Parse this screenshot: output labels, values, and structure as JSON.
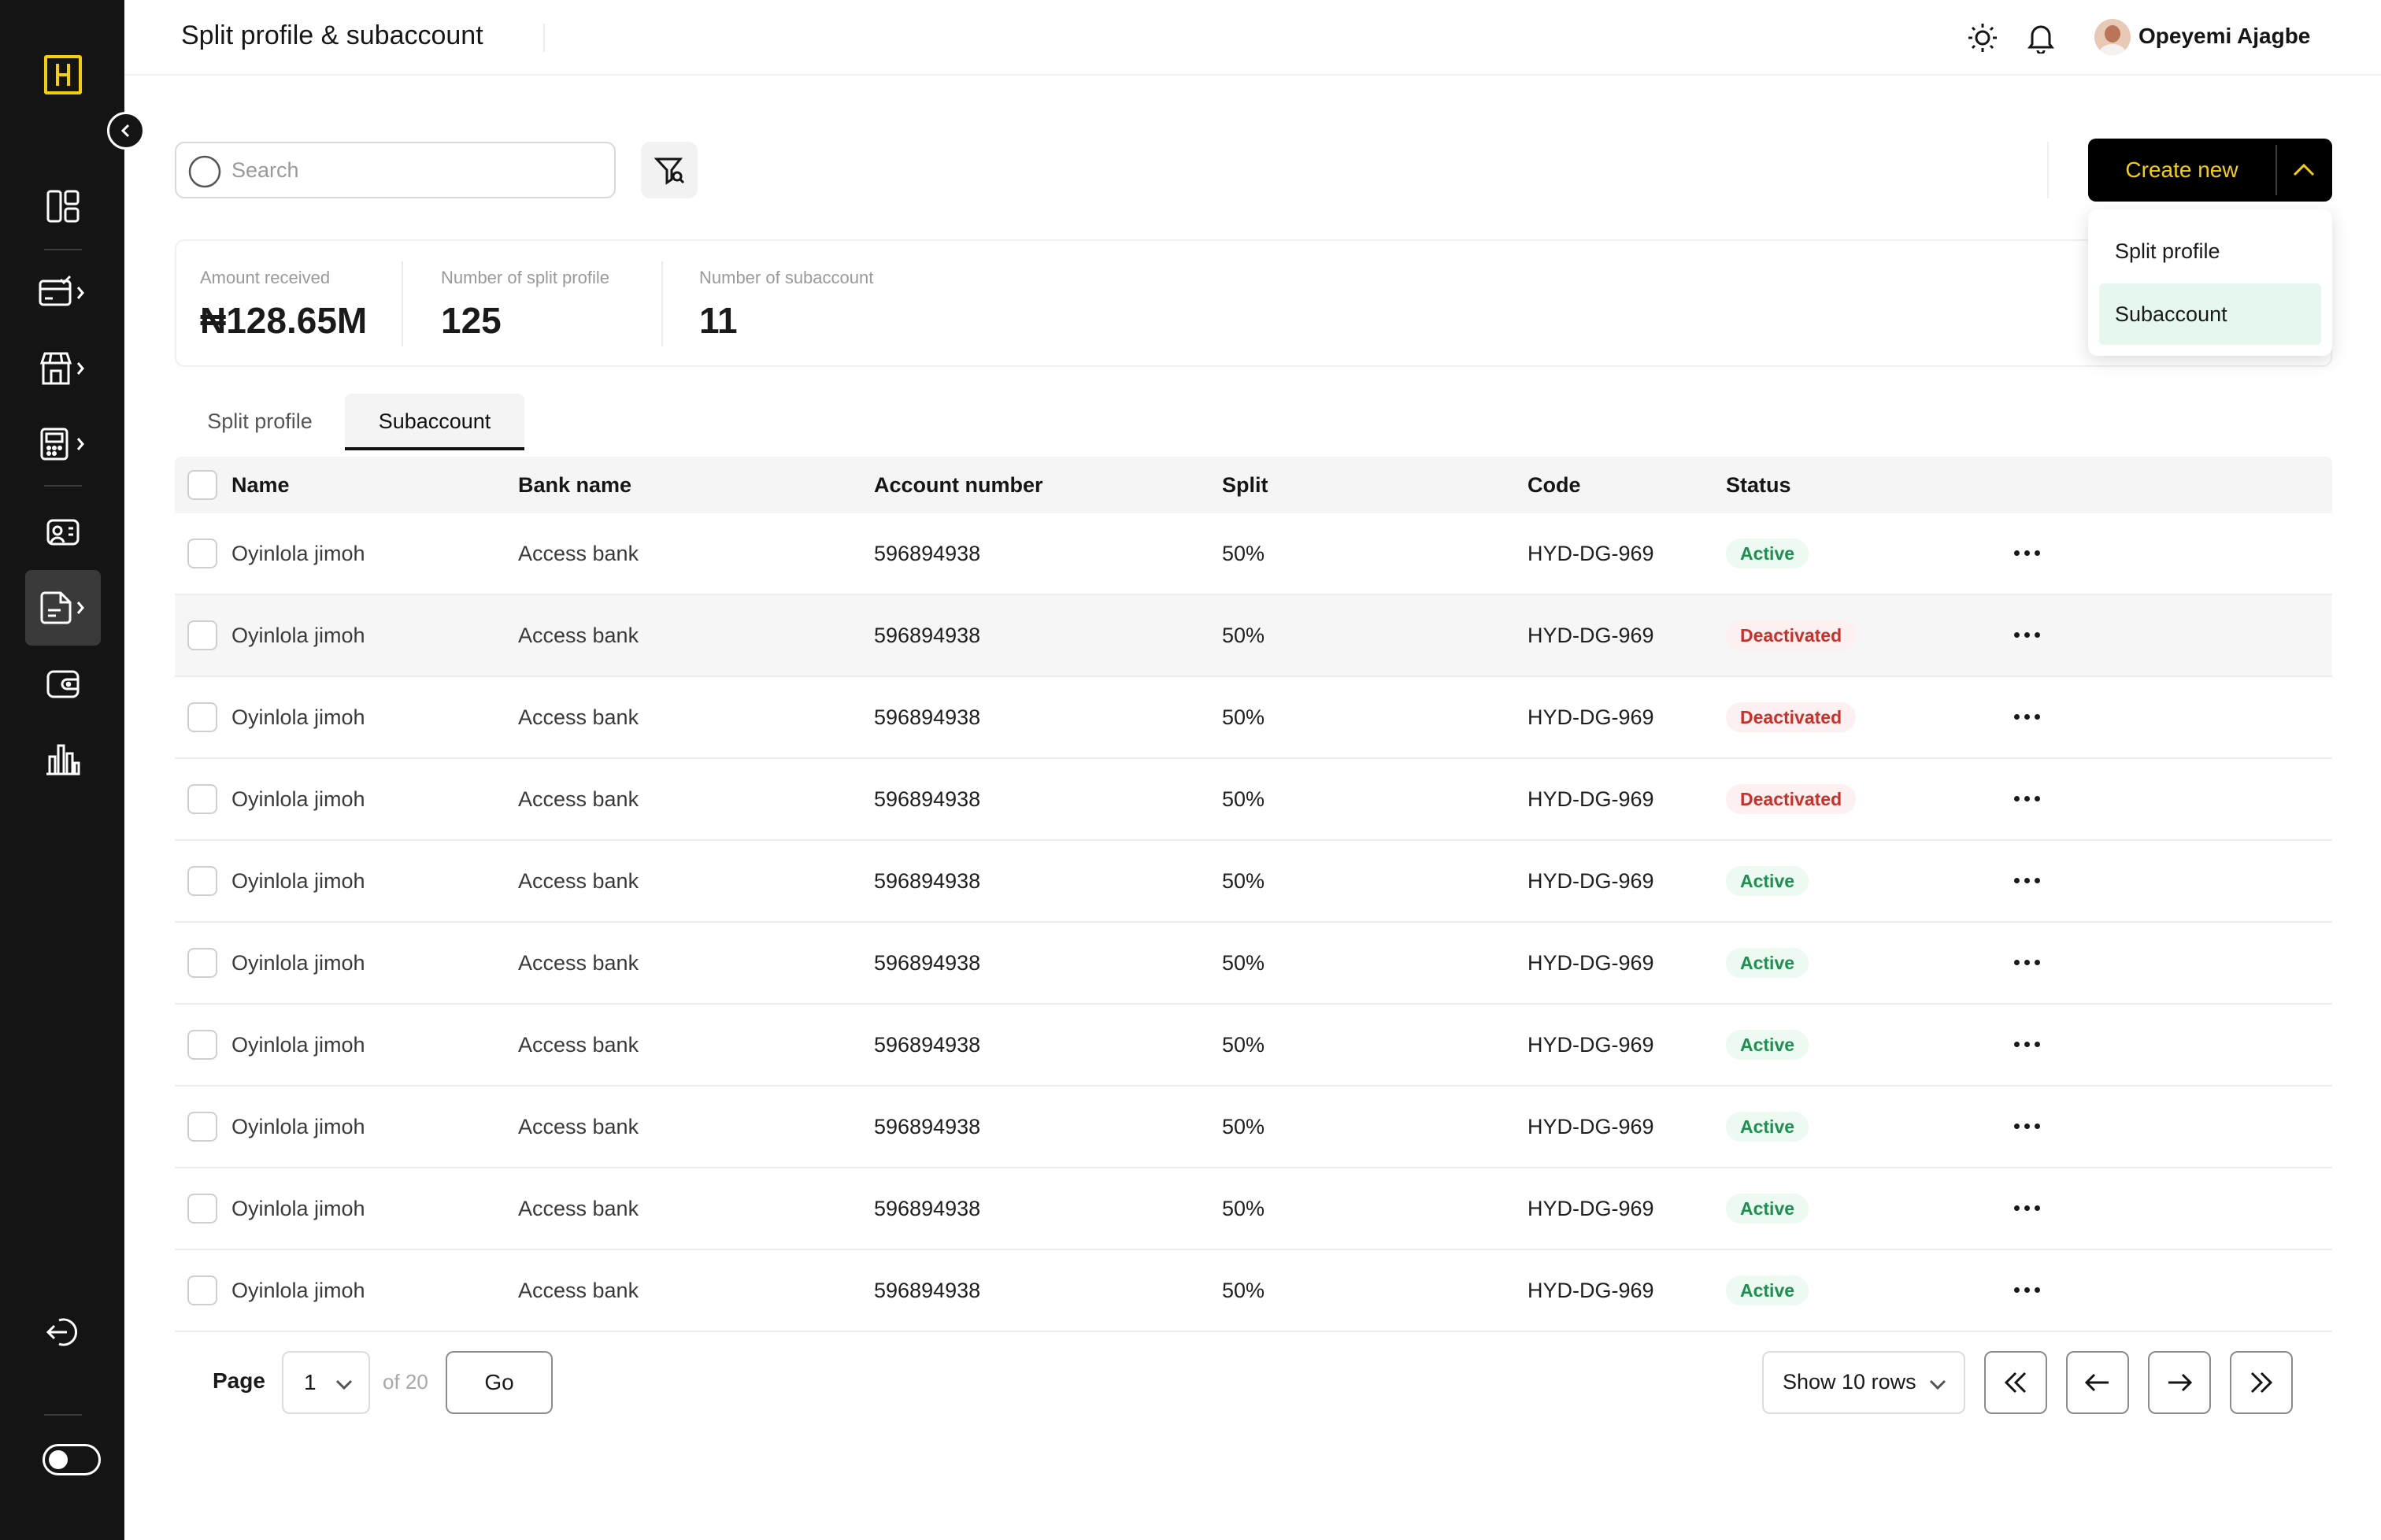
{
  "header": {
    "title": "Split profile & subaccount",
    "user_name": "Opeyemi Ajagbe",
    "icons": [
      "sun-icon",
      "bell-icon",
      "avatar",
      "chevron-down-icon"
    ]
  },
  "sidebar": {
    "logo": "H",
    "items": [
      {
        "name": "dashboard",
        "icon": "dashboard-icon"
      },
      {
        "name": "payments",
        "icon": "card-check-icon"
      },
      {
        "name": "storefront",
        "icon": "store-icon"
      },
      {
        "name": "pos",
        "icon": "pos-terminal-icon"
      },
      {
        "name": "customers",
        "icon": "customer-card-icon"
      },
      {
        "name": "split",
        "icon": "split-document-icon",
        "active": true
      },
      {
        "name": "wallet",
        "icon": "wallet-icon"
      },
      {
        "name": "reports",
        "icon": "bar-chart-icon"
      }
    ],
    "logout_icon": "logout-icon",
    "theme_toggle": "toggle-icon"
  },
  "toolbar": {
    "search_placeholder": "Search",
    "create_label": "Create new",
    "create_menu": [
      "Split profile",
      "Subaccount"
    ],
    "create_menu_selected": "Subaccount"
  },
  "stats": [
    {
      "label": "Amount received",
      "value": "₦128.65M"
    },
    {
      "label": "Number of split profile",
      "value": "125"
    },
    {
      "label": "Number of subaccount",
      "value": "11"
    }
  ],
  "tabs": [
    {
      "label": "Split profile",
      "active": false
    },
    {
      "label": "Subaccount",
      "active": true
    }
  ],
  "table": {
    "columns": [
      "Name",
      "Bank name",
      "Account number",
      "Split",
      "Code",
      "Status"
    ],
    "rows": [
      {
        "name": "Oyinlola jimoh",
        "bank": "Access bank",
        "account": "596894938",
        "split": "50%",
        "code": "HYD-DG-969",
        "status": "Active"
      },
      {
        "name": "Oyinlola jimoh",
        "bank": "Access bank",
        "account": "596894938",
        "split": "50%",
        "code": "HYD-DG-969",
        "status": "Deactivated"
      },
      {
        "name": "Oyinlola jimoh",
        "bank": "Access bank",
        "account": "596894938",
        "split": "50%",
        "code": "HYD-DG-969",
        "status": "Deactivated"
      },
      {
        "name": "Oyinlola jimoh",
        "bank": "Access bank",
        "account": "596894938",
        "split": "50%",
        "code": "HYD-DG-969",
        "status": "Deactivated"
      },
      {
        "name": "Oyinlola jimoh",
        "bank": "Access bank",
        "account": "596894938",
        "split": "50%",
        "code": "HYD-DG-969",
        "status": "Active"
      },
      {
        "name": "Oyinlola jimoh",
        "bank": "Access bank",
        "account": "596894938",
        "split": "50%",
        "code": "HYD-DG-969",
        "status": "Active"
      },
      {
        "name": "Oyinlola jimoh",
        "bank": "Access bank",
        "account": "596894938",
        "split": "50%",
        "code": "HYD-DG-969",
        "status": "Active"
      },
      {
        "name": "Oyinlola jimoh",
        "bank": "Access bank",
        "account": "596894938",
        "split": "50%",
        "code": "HYD-DG-969",
        "status": "Active"
      },
      {
        "name": "Oyinlola jimoh",
        "bank": "Access bank",
        "account": "596894938",
        "split": "50%",
        "code": "HYD-DG-969",
        "status": "Active"
      },
      {
        "name": "Oyinlola jimoh",
        "bank": "Access bank",
        "account": "596894938",
        "split": "50%",
        "code": "HYD-DG-969",
        "status": "Active"
      }
    ],
    "highlighted_row": 1
  },
  "pagination": {
    "page_label": "Page",
    "current_page": "1",
    "of_total": "of 20",
    "go_label": "Go",
    "rows_label": "Show 10 rows"
  },
  "colors": {
    "sidebar_bg": "#141414",
    "brand_yellow": "#f5d000",
    "active_status": "#1d8f4e",
    "deactivated_status": "#c8302b",
    "dropdown_selected_bg": "#e6f7ee"
  }
}
